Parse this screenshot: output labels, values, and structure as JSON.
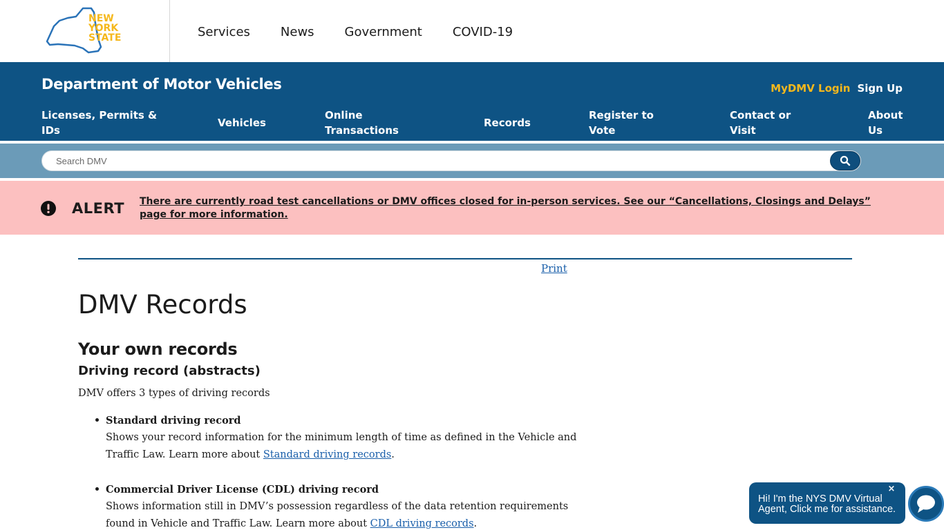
{
  "global_nav": {
    "logo_alt": "NEW YORK STATE",
    "logo_lines": [
      "NEW",
      "YORK",
      "STATE"
    ],
    "items": [
      "Services",
      "News",
      "Government",
      "COVID-19"
    ]
  },
  "agency": {
    "title": "Department of Motor Vehicles",
    "mydmv_login": "MyDMV Login",
    "sign_up": "Sign Up",
    "nav": [
      "Licenses, Permits & IDs",
      "Vehicles",
      "Online Transactions",
      "Records",
      "Register to Vote",
      "Contact or Visit",
      "About Us"
    ]
  },
  "search": {
    "placeholder": "Search DMV",
    "icon": "search-icon"
  },
  "alert": {
    "icon": "exclamation-circle-icon",
    "label": "ALERT",
    "message": "There are currently road test cancellations or DMV offices closed for in-person services. See our “Cancellations, Closings and Delays” page for more information."
  },
  "content": {
    "print_label": "Print",
    "page_title": "DMV Records",
    "section_title": "Your own records",
    "subsection_title": "Driving record (abstracts)",
    "intro": "DMV offers 3 types of driving records",
    "records": [
      {
        "title": "Standard driving record",
        "text": "Shows your record information for the minimum length of time as defined in the Vehicle and Traffic Law. Learn more about ",
        "link": "Standard driving records",
        "suffix": "."
      },
      {
        "title": "Commercial Driver License (CDL) driving record",
        "text": "Shows information still in DMV’s possession regardless of the data retention requirements found in Vehicle and Traffic Law. Learn more about ",
        "link": "CDL driving records",
        "suffix": "."
      }
    ]
  },
  "chat": {
    "message": "Hi! I'm the NYS DMV Virtual Agent, Click me for assistance.",
    "close": "×",
    "icon": "chat-bubble-icon"
  },
  "colors": {
    "brand_blue": "#0e5384",
    "search_band": "#6b9bb8",
    "alert_bg": "#fcc0c0",
    "link": "#1a5faa",
    "logo_gold": "#f5b81c"
  }
}
